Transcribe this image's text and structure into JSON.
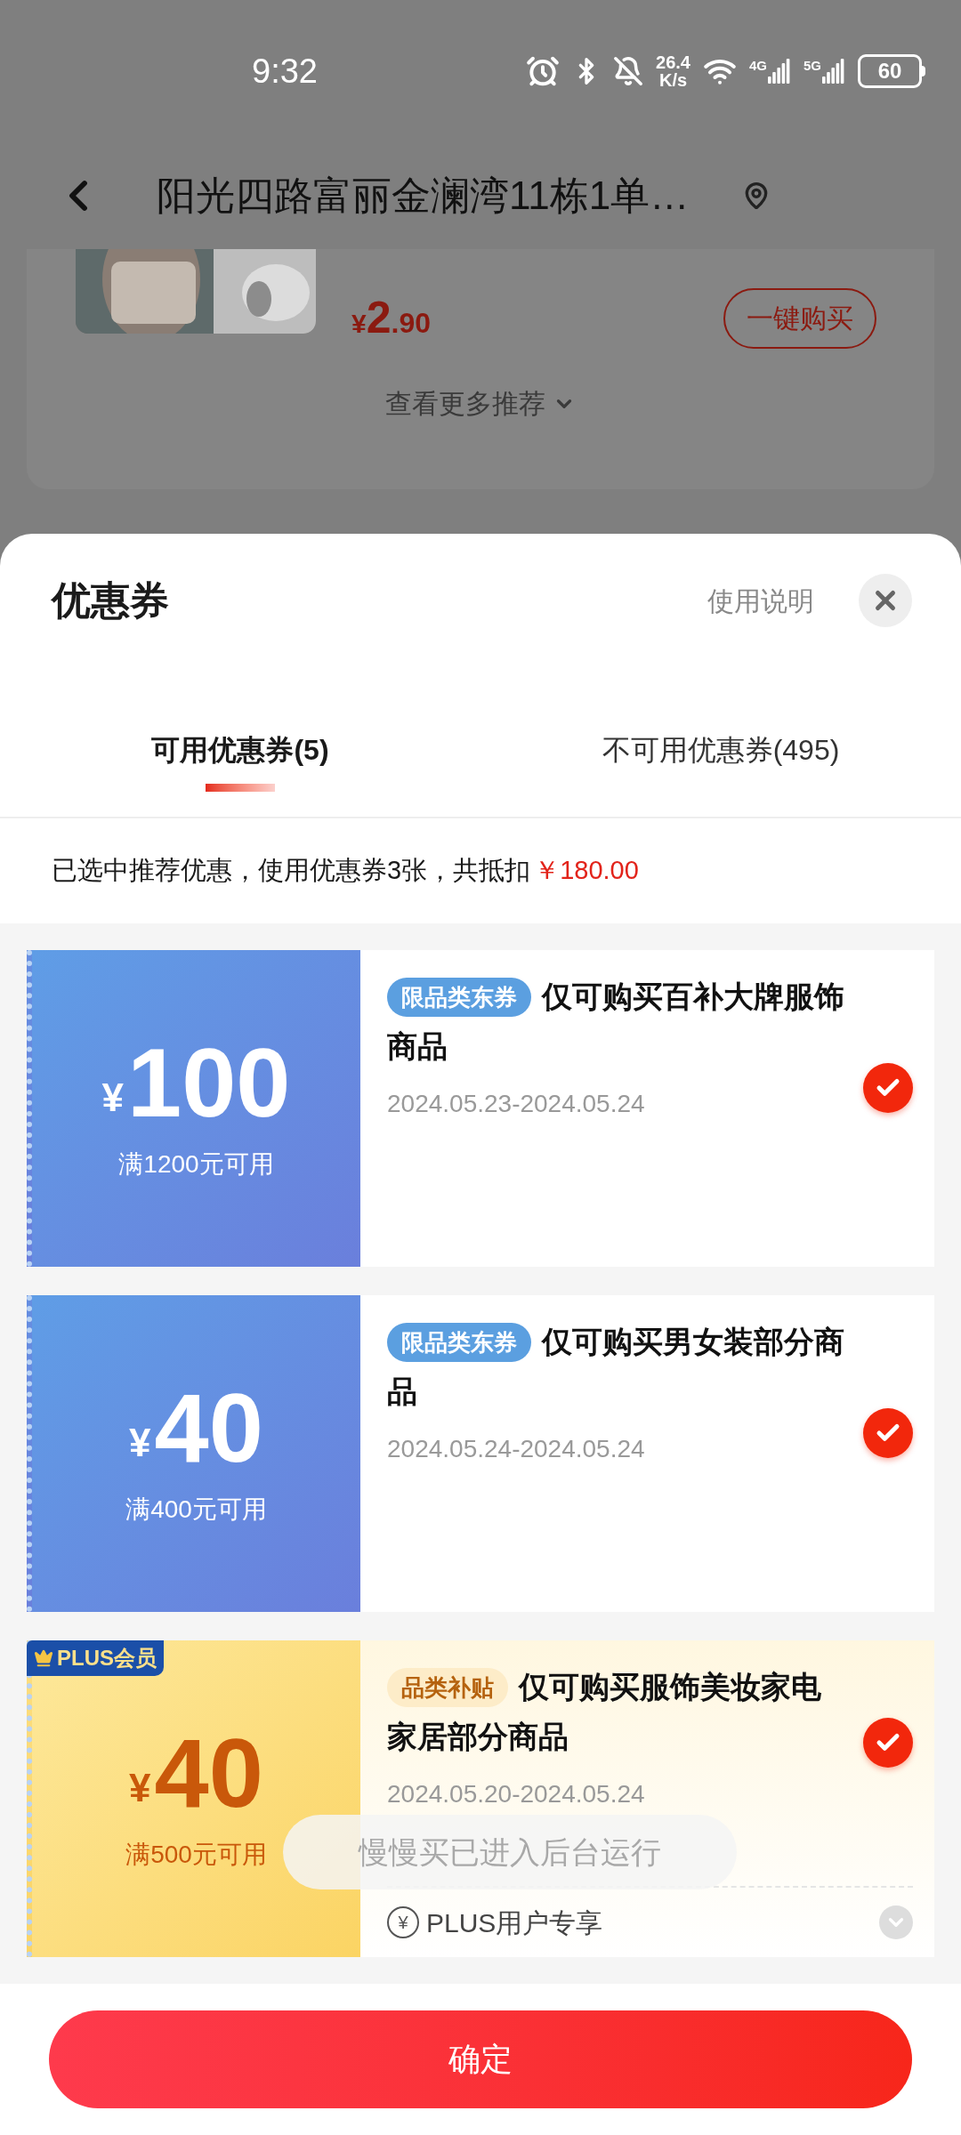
{
  "status_bar": {
    "time": "9:32",
    "speed": "26.4",
    "speed_unit": "K/s",
    "net1": "4G",
    "net2": "5G",
    "battery": "60"
  },
  "header": {
    "address": "阳光四路富丽金澜湾11栋1单…"
  },
  "product": {
    "currency": "¥",
    "price_int": "2",
    "price_dec": ".90",
    "buy_button": "一键购买",
    "more": "查看更多推荐"
  },
  "sheet": {
    "title": "优惠券",
    "help": "使用说明",
    "tabs": [
      {
        "label": "可用优惠券(5)",
        "selected": true
      },
      {
        "label": "不可用优惠券(495)",
        "selected": false
      }
    ],
    "summary": "已选中推荐优惠，使用优惠券3张，共抵扣",
    "summary_amount": "￥180.00",
    "coupons": [
      {
        "kind": "blue",
        "currency": "¥",
        "amount": "100",
        "condition": "满1200元可用",
        "tag": "限品类东券",
        "title": "仅可购买百补大牌服饰商品",
        "dates": "2024.05.23-2024.05.24",
        "selected": true
      },
      {
        "kind": "blue",
        "currency": "¥",
        "amount": "40",
        "condition": "满400元可用",
        "tag": "限品类东券",
        "title": "仅可购买男女装部分商品",
        "dates": "2024.05.24-2024.05.24",
        "selected": true
      },
      {
        "kind": "plus",
        "badge": "PLUS会员",
        "currency": "¥",
        "amount": "40",
        "condition": "满500元可用",
        "tag": "品类补贴",
        "title": "仅可购买服饰美妆家电家居部分商品",
        "dates": "2024.05.20-2024.05.24",
        "selected": true,
        "footer_icon": "¥",
        "footer": "PLUS用户专享"
      }
    ],
    "confirm": "确定"
  },
  "toast": "慢慢买已进入后台运行"
}
